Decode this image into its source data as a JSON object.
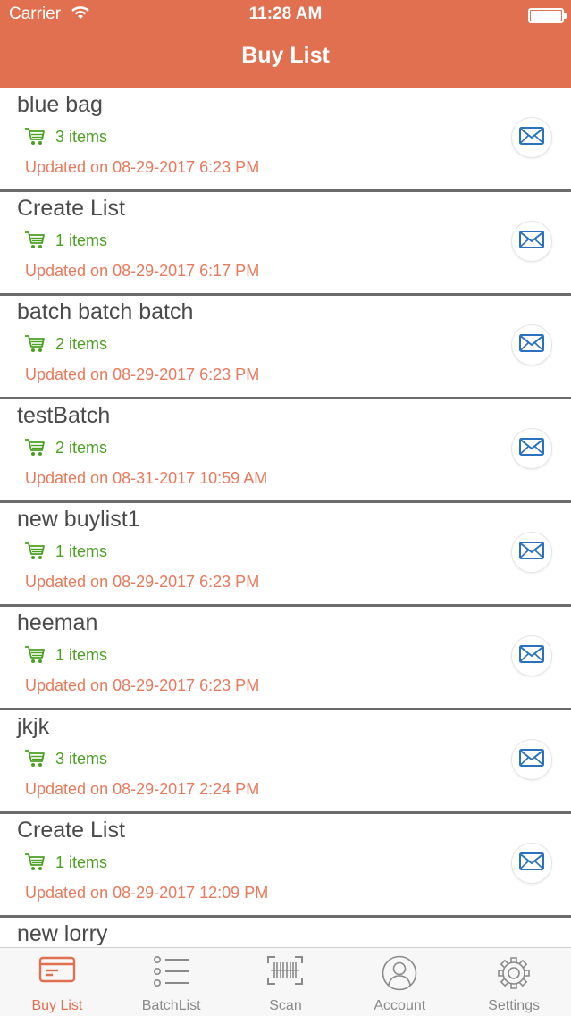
{
  "status_bar": {
    "carrier": "Carrier",
    "time": "11:28 AM"
  },
  "nav": {
    "title": "Buy List"
  },
  "lists": [
    {
      "name": "blue bag",
      "count": "3 items",
      "updated": "Updated on 08-29-2017 6:23 PM"
    },
    {
      "name": "Create List",
      "count": "1 items",
      "updated": "Updated on 08-29-2017 6:17 PM"
    },
    {
      "name": "batch batch batch",
      "count": "2 items",
      "updated": "Updated on 08-29-2017 6:23 PM"
    },
    {
      "name": "testBatch",
      "count": "2 items",
      "updated": "Updated on 08-31-2017 10:59 AM"
    },
    {
      "name": "new buylist1",
      "count": "1 items",
      "updated": "Updated on 08-29-2017 6:23 PM"
    },
    {
      "name": "heeman",
      "count": "1 items",
      "updated": "Updated on 08-29-2017 6:23 PM"
    },
    {
      "name": "jkjk",
      "count": "3 items",
      "updated": "Updated on 08-29-2017 2:24 PM"
    },
    {
      "name": "Create List",
      "count": "1 items",
      "updated": "Updated on 08-29-2017 12:09 PM"
    },
    {
      "name": "new lorry",
      "count": "",
      "updated": ""
    }
  ],
  "tabs": [
    {
      "label": "Buy List",
      "icon": "buy-list-icon",
      "active": true
    },
    {
      "label": "BatchList",
      "icon": "batch-list-icon",
      "active": false
    },
    {
      "label": "Scan",
      "icon": "barcode-scan-icon",
      "active": false
    },
    {
      "label": "Account",
      "icon": "account-icon",
      "active": false
    },
    {
      "label": "Settings",
      "icon": "gear-icon",
      "active": false
    }
  ],
  "colors": {
    "accent": "#e07050",
    "items_green": "#4aa021",
    "updated_orange": "#e9795c",
    "mail_blue": "#2a72c0",
    "inactive_gray": "#8a8a8a"
  }
}
